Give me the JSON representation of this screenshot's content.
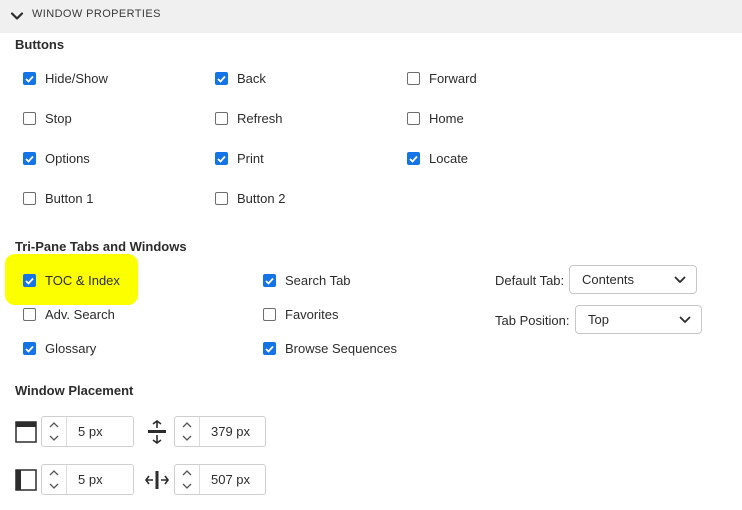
{
  "header": {
    "title": "WINDOW PROPERTIES"
  },
  "buttons_section": {
    "title": "Buttons",
    "items": [
      {
        "label": "Hide/Show",
        "checked": true
      },
      {
        "label": "Back",
        "checked": true
      },
      {
        "label": "Forward",
        "checked": false
      },
      {
        "label": "Stop",
        "checked": false
      },
      {
        "label": "Refresh",
        "checked": false
      },
      {
        "label": "Home",
        "checked": false
      },
      {
        "label": "Options",
        "checked": true
      },
      {
        "label": "Print",
        "checked": true
      },
      {
        "label": "Locate",
        "checked": true
      },
      {
        "label": "Button 1",
        "checked": false
      },
      {
        "label": "Button 2",
        "checked": false
      }
    ]
  },
  "tripane": {
    "title": "Tri-Pane Tabs and Windows",
    "items": [
      {
        "label": "TOC & Index",
        "checked": true,
        "highlighted": true
      },
      {
        "label": "Search Tab",
        "checked": true
      },
      {
        "label": "Adv. Search",
        "checked": false
      },
      {
        "label": "Favorites",
        "checked": false
      },
      {
        "label": "Glossary",
        "checked": true
      },
      {
        "label": "Browse Sequences",
        "checked": true
      }
    ],
    "default_tab": {
      "label": "Default Tab:",
      "value": "Contents"
    },
    "tab_position": {
      "label": "Tab Position:",
      "value": "Top"
    }
  },
  "placement": {
    "title": "Window Placement",
    "top": "5 px",
    "height": "379 px",
    "left": "5 px",
    "width": "507 px"
  },
  "colors": {
    "accent": "#1473e6",
    "highlight": "#fbff00",
    "header_bg": "#f0f0f0"
  }
}
